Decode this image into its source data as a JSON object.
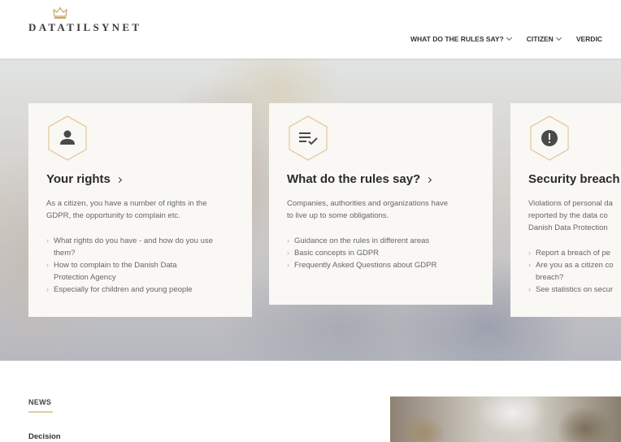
{
  "header": {
    "logo_text": "DATATILSYNET",
    "nav": [
      {
        "label": "WHAT DO THE RULES SAY?"
      },
      {
        "label": "CITIZEN"
      },
      {
        "label": "VERDIC"
      }
    ]
  },
  "cards": [
    {
      "title": "Your rights",
      "icon": "person-icon",
      "desc": [
        "As a citizen, you have a number of rights in the",
        "GDPR, the opportunity to complain etc."
      ],
      "links": [
        [
          "What rights do you have - and how do you use",
          "them?"
        ],
        [
          "How to complain to the Danish Data",
          "Protection Agency"
        ],
        [
          "Especially for children and young people"
        ]
      ]
    },
    {
      "title": "What do the rules say?",
      "icon": "list-check-icon",
      "desc": [
        "Companies, authorities and organizations have",
        "to live up to some obligations."
      ],
      "links": [
        [
          "Guidance on the rules in different areas"
        ],
        [
          "Basic concepts in GDPR"
        ],
        [
          "Frequently Asked Questions about GDPR"
        ]
      ]
    },
    {
      "title": "Security breach",
      "icon": "alert-icon",
      "desc": [
        "Violations of personal da",
        "reported by the data co",
        "Danish Data Protection"
      ],
      "links": [
        [
          "Report a breach of pe"
        ],
        [
          "Are you as a citizen co",
          "breach?"
        ],
        [
          "See statistics on secur"
        ]
      ]
    }
  ],
  "news": {
    "label": "NEWS",
    "first_category": "Decision"
  },
  "colors": {
    "accent": "#e5c9a0",
    "icon_dark": "#4a4a4a",
    "card_bg": "#f9f8f4"
  }
}
